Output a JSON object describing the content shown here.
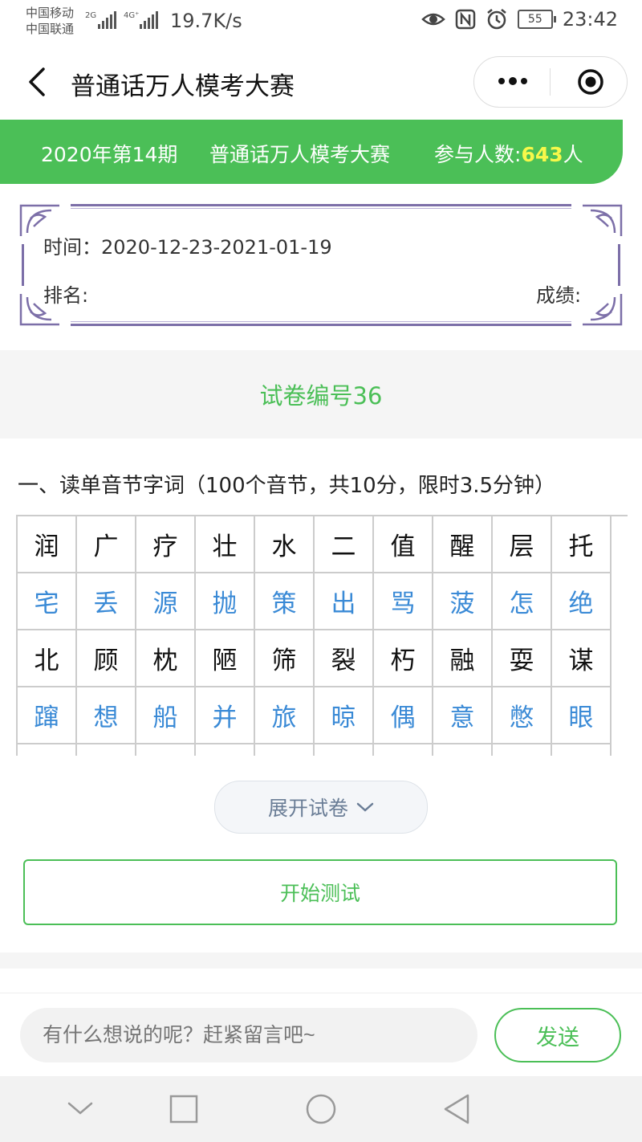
{
  "status_bar": {
    "carrier1": "中国移动",
    "carrier2": "中国联通",
    "net1": "2G",
    "net2": "4G⁺",
    "speed": "19.7K/s",
    "battery": "55",
    "time": "23:42"
  },
  "nav": {
    "title": "普通话万人模考大赛"
  },
  "banner": {
    "issue": "2020年第14期",
    "name": "普通话万人模考大赛",
    "participants_label": "参与人数:",
    "participants_count": "643",
    "participants_unit": "人"
  },
  "info": {
    "time_label": "时间：",
    "time_value": "2020-12-23-2021-01-19",
    "rank_label": "排名:",
    "score_label": "成绩:"
  },
  "paper": {
    "number": "试卷编号36",
    "section1_title": "一、读单音节字词（100个音节，共10分，限时3.5分钟）",
    "rows": [
      [
        "润",
        "广",
        "疗",
        "壮",
        "水",
        "二",
        "值",
        "醒",
        "层",
        "托"
      ],
      [
        "宅",
        "丢",
        "源",
        "抛",
        "策",
        "出",
        "骂",
        "菠",
        "怎",
        "绝"
      ],
      [
        "北",
        "顾",
        "枕",
        "陋",
        "筛",
        "裂",
        "朽",
        "融",
        "耍",
        "谋"
      ],
      [
        "蹿",
        "想",
        "船",
        "并",
        "旅",
        "晾",
        "偶",
        "意",
        "憋",
        "眼"
      ],
      [
        "",
        "",
        "",
        "",
        "",
        "",
        "",
        "",
        "",
        ""
      ]
    ]
  },
  "actions": {
    "expand_label": "展开试卷",
    "start_label": "开始测试"
  },
  "comment": {
    "placeholder": "有什么想说的呢？赶紧留言吧~",
    "send_label": "发送"
  },
  "colors": {
    "green": "#4bbf57",
    "blue_text": "#3a8ad6",
    "count_yellow": "#f8f84a"
  }
}
